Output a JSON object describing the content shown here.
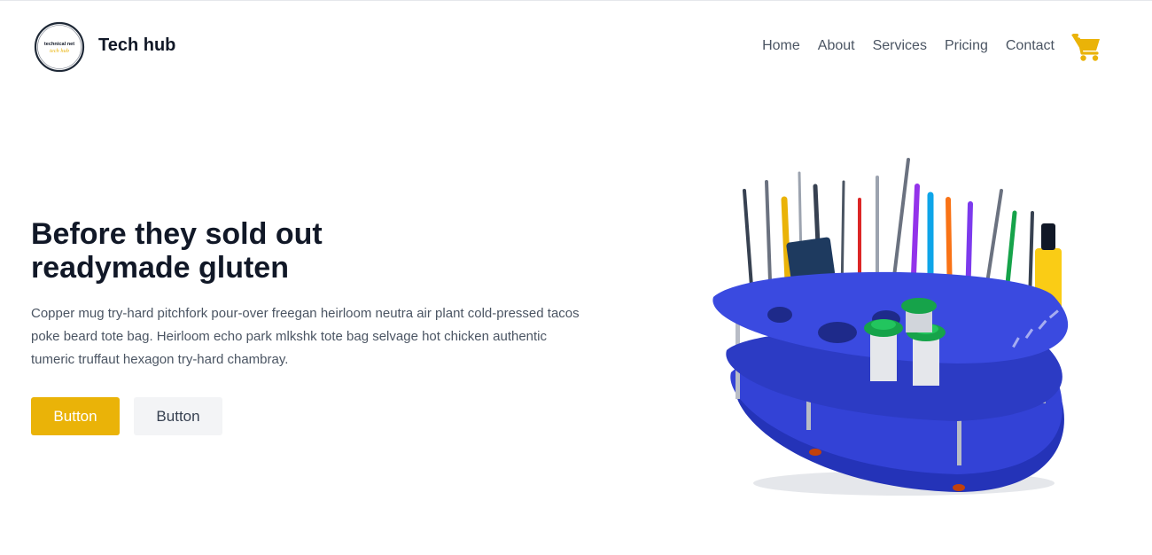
{
  "header": {
    "logo_text_top": "technical net",
    "logo_text_bottom": "tech hub",
    "brand": "Tech hub",
    "nav": [
      "Home",
      "About",
      "Services",
      "Pricing",
      "Contact"
    ],
    "cart_icon": "shopping-cart-icon"
  },
  "hero": {
    "title_line1": "Before they sold out",
    "title_line2": "readymade gluten",
    "description": "Copper mug try-hard pitchfork pour-over freegan heirloom neutra air plant cold-pressed tacos poke beard tote bag. Heirloom echo park mlkshk tote bag selvage hot chicken authentic tumeric truffaut hexagon try-hard chambray.",
    "primary_button": "Button",
    "secondary_button": "Button"
  },
  "colors": {
    "accent": "#eab308",
    "heading": "#111827",
    "body_text": "#4b5563",
    "secondary_button_bg": "#f3f4f6",
    "organizer_blue": "#3342d6"
  }
}
